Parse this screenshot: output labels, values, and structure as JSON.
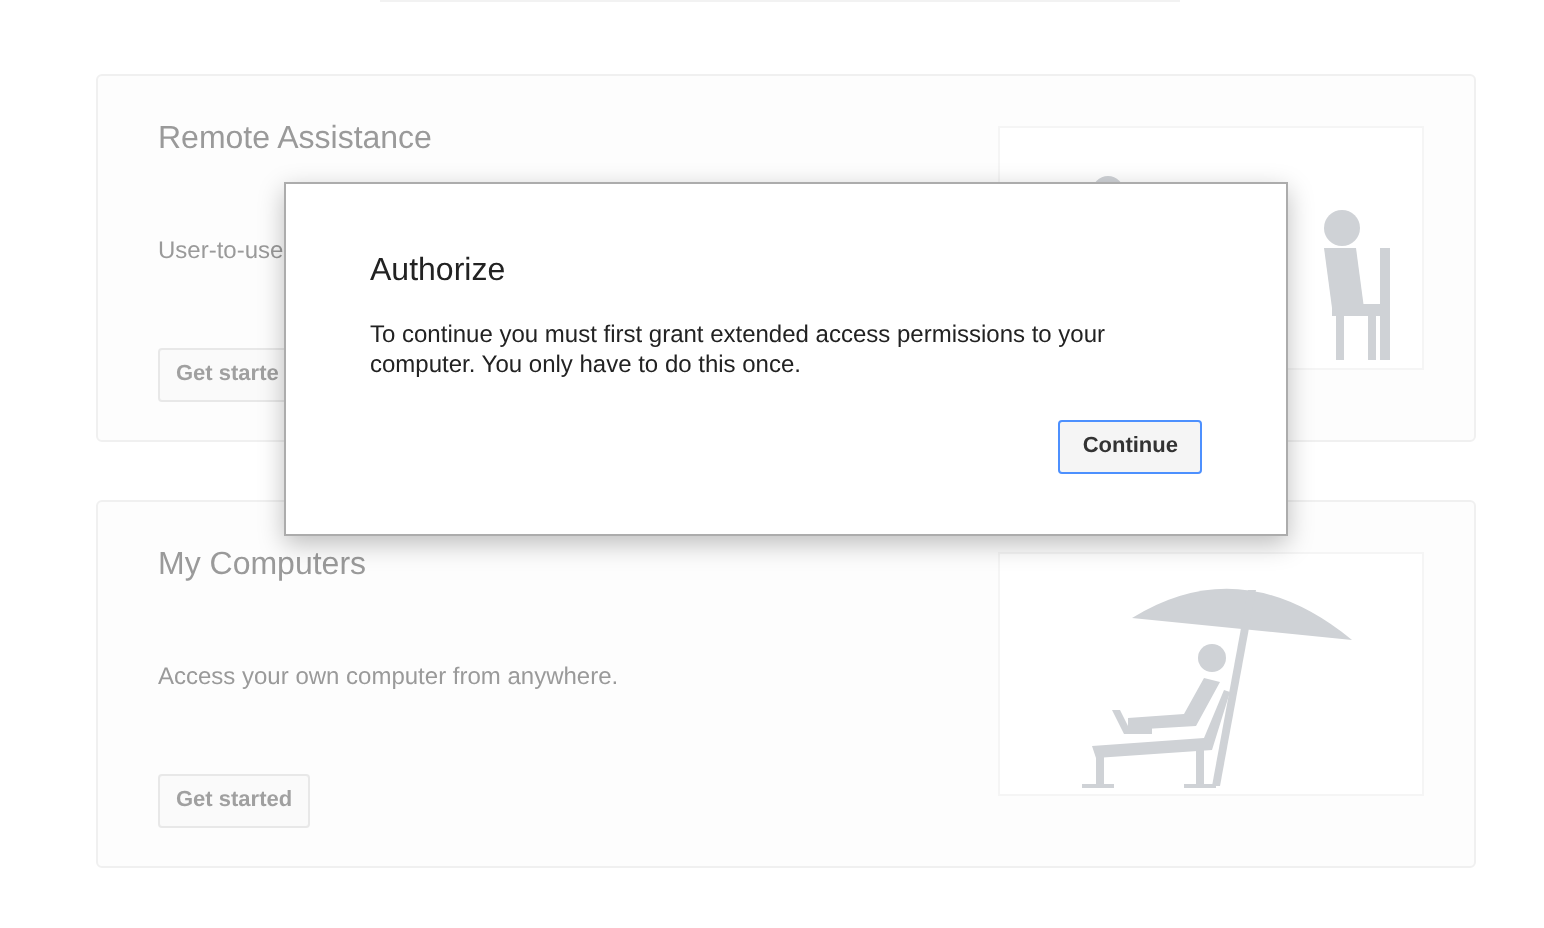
{
  "cards": [
    {
      "title": "Remote Assistance",
      "description": "User-to-use",
      "button": "Get starte",
      "kind": "helper"
    },
    {
      "title": "My Computers",
      "description": "Access your own computer from anywhere.",
      "button": "Get started",
      "kind": "beach"
    }
  ],
  "dialog": {
    "title": "Authorize",
    "message": "To continue you must first grant extended access permissions to your computer. You only have to do this once.",
    "button": "Continue"
  }
}
